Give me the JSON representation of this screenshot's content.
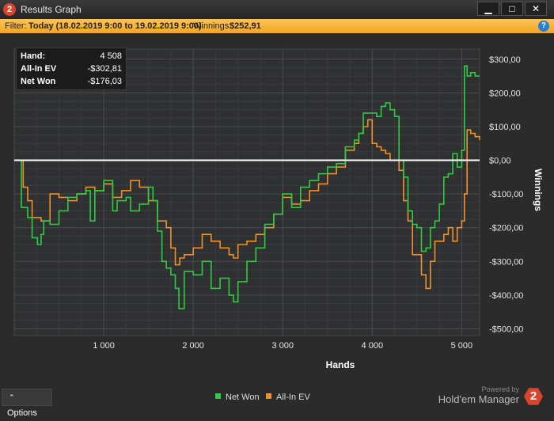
{
  "window": {
    "title": "Results Graph",
    "app_badge": "2",
    "min": "▁",
    "max": "□",
    "close": "✕"
  },
  "filter": {
    "label": "Filter:",
    "value": "Today (18.02.2019 9:00 to 19.02.2019 9:00)",
    "winnings_label": "Winnings:",
    "winnings_value": "$252,91",
    "help": "?"
  },
  "stats": {
    "hand_label": "Hand:",
    "hand_value": "4 508",
    "allin_label": "All-In EV",
    "allin_value": "-$302,81",
    "netwon_label": "Net Won",
    "netwon_value": "-$176,03"
  },
  "footer": {
    "options_label": "Options",
    "powered_by": "Powered by",
    "brand": "Hold'em Manager",
    "brand_badge": "2"
  },
  "colors": {
    "net_won": "#2ecc40",
    "allin_ev": "#f0912a",
    "zero_line": "#ffffff",
    "accent": "#f3a71f"
  },
  "chart_data": {
    "type": "line",
    "xlabel": "Hands",
    "ylabel": "Winnings",
    "xlim": [
      0,
      5200
    ],
    "ylim": [
      -520,
      330
    ],
    "x_ticks": [
      1000,
      2000,
      3000,
      4000,
      5000
    ],
    "x_tick_labels": [
      "1 000",
      "2 000",
      "3 000",
      "4 000",
      "5 000"
    ],
    "y_ticks": [
      300,
      200,
      100,
      0,
      -100,
      -200,
      -300,
      -400,
      -500
    ],
    "y_tick_labels": [
      "$300,00",
      "$200,00",
      "$100,00",
      "$0,00",
      "-$100,00",
      "-$200,00",
      "-$300,00",
      "-$400,00",
      "-$500,00"
    ],
    "grid": true,
    "legend_position": "bottom",
    "series": [
      {
        "name": "Net Won",
        "x": [
          0,
          80,
          150,
          200,
          260,
          300,
          330,
          400,
          500,
          600,
          700,
          800,
          850,
          900,
          1000,
          1100,
          1150,
          1250,
          1300,
          1400,
          1500,
          1550,
          1600,
          1650,
          1700,
          1750,
          1800,
          1840,
          1900,
          2000,
          2100,
          2200,
          2300,
          2400,
          2450,
          2500,
          2600,
          2700,
          2800,
          2900,
          3000,
          3100,
          3200,
          3300,
          3400,
          3500,
          3600,
          3700,
          3800,
          3850,
          3900,
          4000,
          4050,
          4100,
          4150,
          4200,
          4250,
          4300,
          4350,
          4400,
          4450,
          4500,
          4550,
          4600,
          4650,
          4700,
          4750,
          4800,
          4850,
          4900,
          4950,
          5000,
          5030,
          5060,
          5100,
          5150,
          5200
        ],
        "y": [
          0,
          -140,
          -170,
          -230,
          -250,
          -220,
          -180,
          -190,
          -150,
          -110,
          -100,
          -90,
          -180,
          -90,
          -60,
          -150,
          -120,
          -110,
          -150,
          -130,
          -80,
          -120,
          -210,
          -300,
          -320,
          -340,
          -380,
          -440,
          -330,
          -340,
          -300,
          -380,
          -350,
          -400,
          -420,
          -360,
          -300,
          -260,
          -190,
          -160,
          -100,
          -140,
          -80,
          -60,
          -40,
          -20,
          -10,
          40,
          60,
          80,
          140,
          140,
          130,
          160,
          170,
          150,
          130,
          0,
          -50,
          -150,
          -190,
          -200,
          -270,
          -260,
          -200,
          -180,
          -130,
          -50,
          -40,
          20,
          -20,
          30,
          280,
          250,
          260,
          250,
          250
        ]
      },
      {
        "name": "All-In EV",
        "x": [
          0,
          100,
          150,
          200,
          300,
          400,
          500,
          600,
          700,
          800,
          900,
          1000,
          1100,
          1200,
          1300,
          1400,
          1500,
          1600,
          1700,
          1750,
          1800,
          1850,
          1900,
          2000,
          2100,
          2200,
          2300,
          2400,
          2450,
          2500,
          2600,
          2700,
          2800,
          2900,
          3000,
          3100,
          3200,
          3300,
          3400,
          3500,
          3600,
          3700,
          3800,
          3850,
          3900,
          3950,
          4000,
          4050,
          4100,
          4150,
          4200,
          4250,
          4300,
          4350,
          4400,
          4450,
          4500,
          4550,
          4600,
          4650,
          4700,
          4750,
          4800,
          4850,
          4900,
          4950,
          5000,
          5030,
          5060,
          5100,
          5150,
          5200
        ],
        "y": [
          0,
          -80,
          -120,
          -170,
          -180,
          -100,
          -110,
          -120,
          -100,
          -80,
          -90,
          -70,
          -110,
          -90,
          -60,
          -80,
          -120,
          -180,
          -200,
          -260,
          -310,
          -290,
          -280,
          -260,
          -220,
          -240,
          -260,
          -280,
          -290,
          -250,
          -240,
          -220,
          -200,
          -160,
          -110,
          -130,
          -120,
          -90,
          -70,
          -40,
          -20,
          30,
          50,
          80,
          100,
          120,
          50,
          40,
          30,
          20,
          0,
          0,
          -30,
          -120,
          -180,
          -280,
          -280,
          -340,
          -380,
          -300,
          -240,
          -240,
          -220,
          -200,
          -240,
          -200,
          -180,
          -100,
          90,
          80,
          70,
          60
        ]
      }
    ]
  }
}
